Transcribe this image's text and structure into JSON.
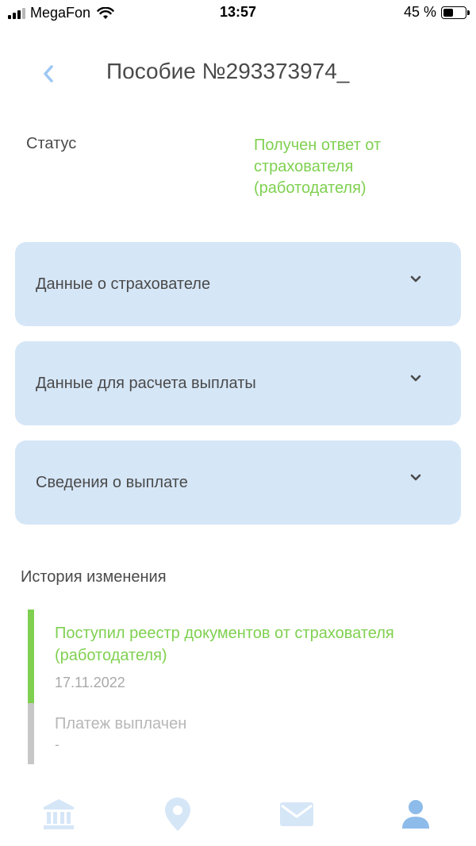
{
  "status_bar": {
    "carrier": "MegaFon",
    "time": "13:57",
    "battery": "45 %",
    "battery_level": 0.45
  },
  "header": {
    "back_icon": "chevron-left-icon",
    "title": "Пособие №293373974_"
  },
  "status": {
    "label": "Статус",
    "value": "Получен ответ от страхователя (работодателя)"
  },
  "sections": [
    {
      "label": "Данные о страхователе",
      "icon": "chevron-down-icon"
    },
    {
      "label": "Данные для расчета выплаты",
      "icon": "chevron-down-icon"
    },
    {
      "label": "Сведения о выплате",
      "icon": "chevron-down-icon"
    }
  ],
  "history": {
    "title": "История изменения",
    "events": [
      {
        "title": "Поступил реестр документов от страхователя (работодателя)",
        "date": "17.11.2022",
        "state": "done"
      },
      {
        "title": "Платеж выплачен",
        "date": "-",
        "state": "pending"
      }
    ]
  },
  "nav": [
    {
      "icon": "bank-icon",
      "active": false
    },
    {
      "icon": "location-pin-icon",
      "active": false
    },
    {
      "icon": "mail-icon",
      "active": false
    },
    {
      "icon": "profile-icon",
      "active": true
    }
  ],
  "colors": {
    "accent_green": "#7fd050",
    "card_bg": "#d5e6f7",
    "nav_inactive": "#d5e6f7",
    "nav_active": "#8dbcea",
    "back_arrow": "#9cc8f2"
  }
}
